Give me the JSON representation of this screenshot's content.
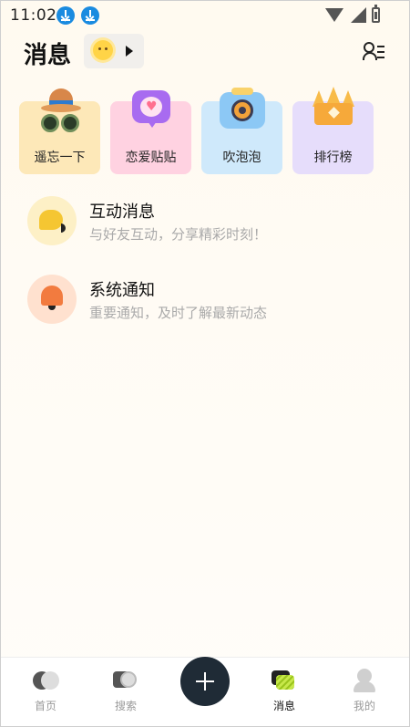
{
  "status_bar": {
    "time": "11:02"
  },
  "header": {
    "title": "消息"
  },
  "cards": [
    {
      "label": "遥忘一下"
    },
    {
      "label": "恋爱贴贴"
    },
    {
      "label": "吹泡泡"
    },
    {
      "label": "排行榜"
    }
  ],
  "messages": [
    {
      "title": "互动消息",
      "subtitle": "与好友互动，分享精彩时刻！"
    },
    {
      "title": "系统通知",
      "subtitle": "重要通知，及时了解最新动态"
    }
  ],
  "nav": {
    "home": "首页",
    "search": "搜索",
    "messages": "消息",
    "me": "我的",
    "active": "messages"
  }
}
